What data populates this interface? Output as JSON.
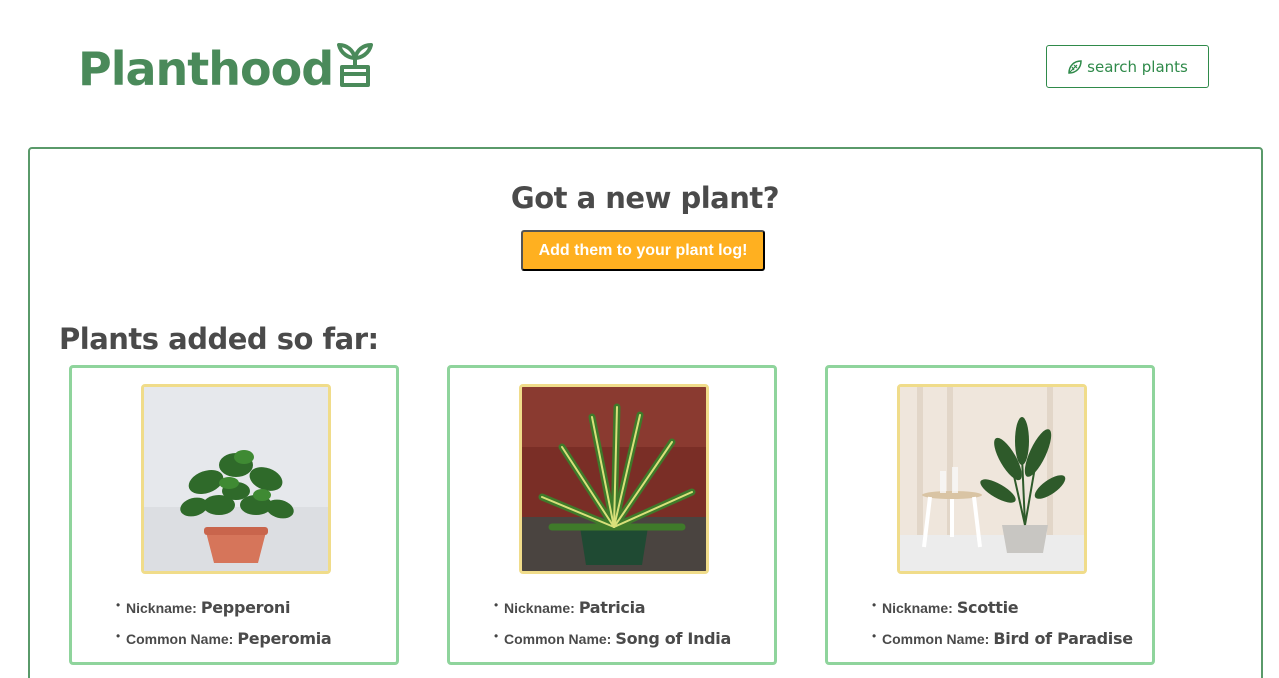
{
  "header": {
    "brand": "Planthood",
    "search_label": "search plants"
  },
  "hero": {
    "headline": "Got a new plant?",
    "cta_label": "Add them to your plant log!"
  },
  "list": {
    "title": "Plants added so far:",
    "nickname_label": "Nickname:",
    "common_label": "Common Name:",
    "plants": [
      {
        "nickname": "Pepperoni",
        "common_name": "Peperomia"
      },
      {
        "nickname": "Patricia",
        "common_name": "Song of India"
      },
      {
        "nickname": "Scottie",
        "common_name": "Bird of Paradise"
      }
    ]
  },
  "colors": {
    "brand_green": "#4a8a5a",
    "accent_orange": "#ffb020",
    "card_border": "#8fd49c",
    "photo_border": "#f0dc8a"
  },
  "icons": {
    "brand": "sprout-pot-icon",
    "search": "leaf-icon"
  }
}
